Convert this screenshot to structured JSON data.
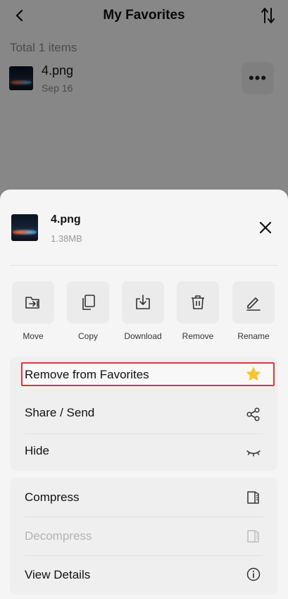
{
  "topbar": {
    "title": "My Favorites",
    "back_icon": "back-arrow-icon",
    "sort_icon": "sort-icon"
  },
  "list": {
    "total": "Total 1 items",
    "file": {
      "name": "4.png",
      "date": "Sep 16",
      "more_label": "•••"
    }
  },
  "sheet": {
    "file_name": "4.png",
    "file_size": "1.38MB",
    "actions": [
      {
        "label": "Move",
        "icon": "move-icon"
      },
      {
        "label": "Copy",
        "icon": "copy-icon"
      },
      {
        "label": "Download",
        "icon": "download-icon"
      },
      {
        "label": "Remove",
        "icon": "trash-icon"
      },
      {
        "label": "Rename",
        "icon": "pencil-icon"
      }
    ],
    "menu_group1": [
      {
        "label": "Remove from Favorites",
        "icon": "star-icon",
        "highlighted": true
      },
      {
        "label": "Share / Send",
        "icon": "share-icon"
      },
      {
        "label": "Hide",
        "icon": "eye-closed-icon"
      }
    ],
    "menu_group2": [
      {
        "label": "Compress",
        "icon": "compress-icon",
        "enabled": true
      },
      {
        "label": "Decompress",
        "icon": "decompress-icon",
        "enabled": false
      },
      {
        "label": "View Details",
        "icon": "info-icon",
        "enabled": true
      }
    ]
  },
  "colors": {
    "highlight_border": "#e0353d",
    "star": "#f5c431",
    "overlay": "rgba(0,0,0,0.45)"
  }
}
